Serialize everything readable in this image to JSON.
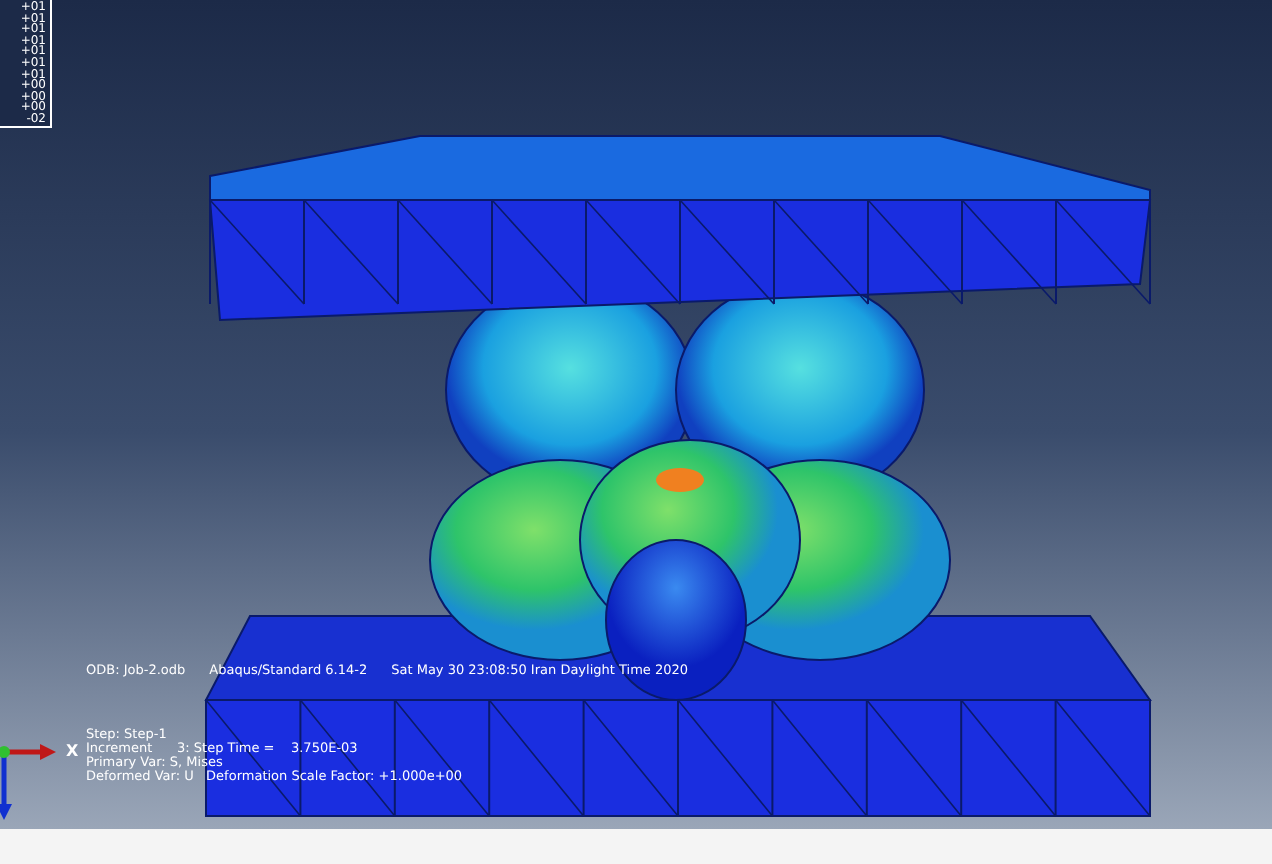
{
  "legend": {
    "values": [
      "+01",
      "+01",
      "+01",
      "+01",
      "+01",
      "+01",
      "+01",
      "+00",
      "+00",
      "+00",
      "-02"
    ]
  },
  "info": {
    "odb": "ODB: Job-2.odb",
    "solver": "Abaqus/Standard 6.14-2",
    "date": "Sat May 30 23:08:50 Iran Daylight Time 2020"
  },
  "state_block": {
    "lines": [
      "Step: Step-1",
      "Increment      3: Step Time =    3.750E-03",
      "Primary Var: S, Mises",
      "Deformed Var: U   Deformation Scale Factor: +1.000e+00"
    ]
  },
  "triad": {
    "x_label": "X"
  }
}
